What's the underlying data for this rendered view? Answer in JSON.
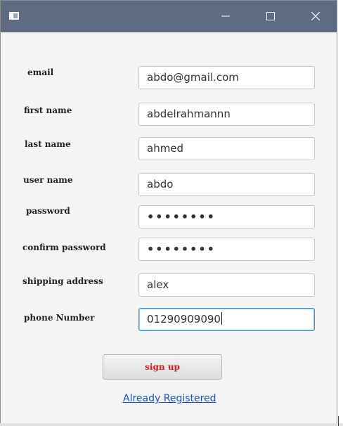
{
  "window": {
    "controls": {
      "minimize_icon": "minimize-icon",
      "maximize_icon": "maximize-icon",
      "close_icon": "close-icon"
    }
  },
  "form": {
    "fields": [
      {
        "label": "email",
        "value": "abdo@gmail.com",
        "type": "text"
      },
      {
        "label": "first name",
        "value": "abdelrahmannn",
        "type": "text"
      },
      {
        "label": "last name",
        "value": "ahmed",
        "type": "text"
      },
      {
        "label": "user name",
        "value": "abdo",
        "type": "text"
      },
      {
        "label": "password",
        "value": "••••••••",
        "type": "password"
      },
      {
        "label": "confirm password",
        "value": "••••••••",
        "type": "password"
      },
      {
        "label": "shipping address",
        "value": "alex",
        "type": "text"
      },
      {
        "label": "phone Number",
        "value": "01290909090",
        "type": "text",
        "focused": true
      }
    ],
    "signup_label": "sign up",
    "already_registered_label": "Already Registered"
  },
  "colors": {
    "titlebar": "#5e6b80",
    "signup_text": "#e8131b",
    "link": "#1652c8",
    "focus_border": "#3d95d9"
  }
}
